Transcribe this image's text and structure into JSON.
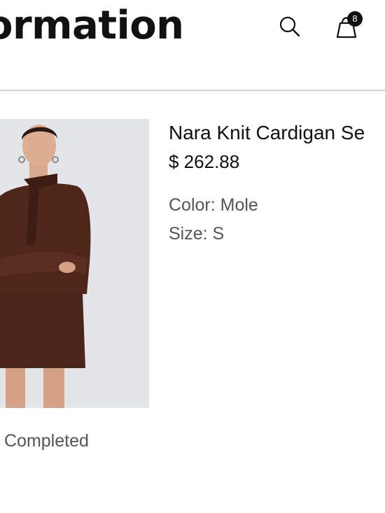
{
  "header": {
    "title": "ormation",
    "search_icon": "search-icon",
    "bag_icon": "shopping-bag-icon",
    "cart_count": "8"
  },
  "product": {
    "name": "Nara Knit Cardigan Se",
    "price": "$ 262.88",
    "color_line": "Color: Mole",
    "size_line": "Size: S",
    "image_colors": {
      "background": "#e3e5e9",
      "garment": "#4a2519",
      "skin": "#d8a78c"
    }
  },
  "order": {
    "status": "Completed"
  }
}
